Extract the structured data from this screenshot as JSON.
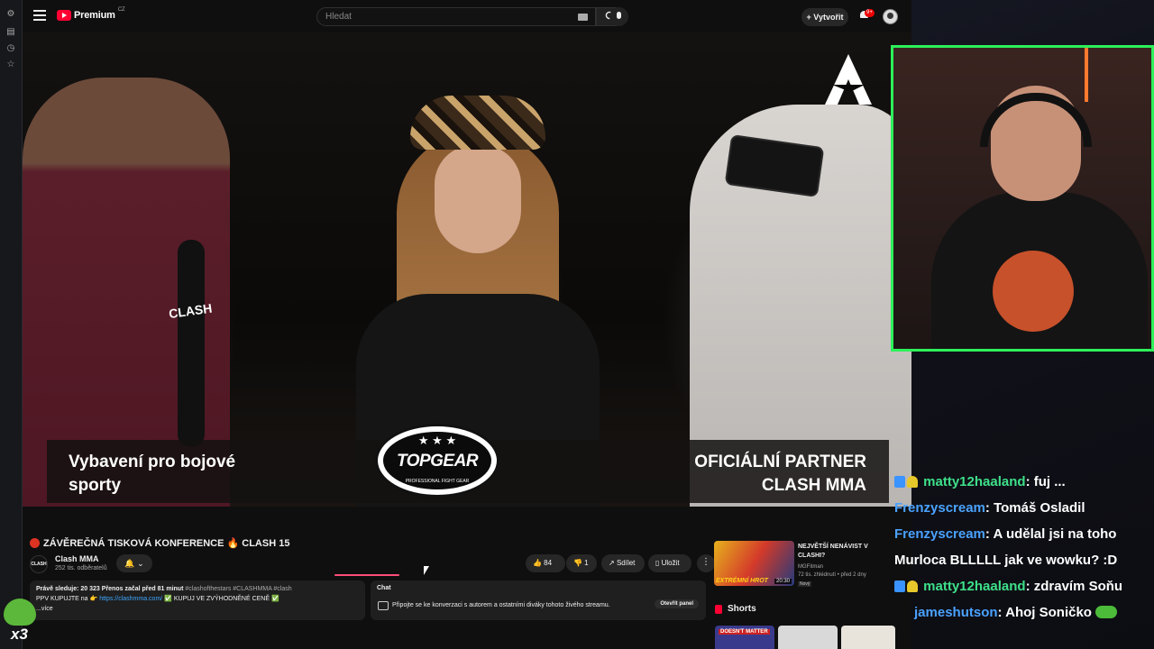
{
  "browser": {
    "rail_icons": [
      "settings-icon",
      "bookmark-icon",
      "history-icon",
      "star-icon"
    ]
  },
  "masthead": {
    "logo_text": "Premium",
    "logo_country": "CZ",
    "search_placeholder": "Hledat",
    "create_label": "+ Vytvořit",
    "notification_count": "9+"
  },
  "video": {
    "mic_label": "CLASH",
    "promo_left": "Vybavení pro bojové sporty",
    "promo_right": "OFICIÁLNÍ PARTNER CLASH MMA",
    "promo_brand": "TOPGEAR",
    "promo_brand_stars": "★ ★ ★",
    "promo_brand_sub": "PROFESSIONAL FIGHT GEAR"
  },
  "info": {
    "title": "ZÁVĚREČNÁ TISKOVÁ KONFERENCE 🔥 CLASH 15",
    "channel_name": "Clash MMA",
    "channel_logo": "CLASH",
    "subscribers": "252 tis. odběratelů",
    "subscribe_label": "🔔 ⌄",
    "likes": "👍 84",
    "dislikes": "👎 1",
    "share_label": "Sdílet",
    "save_label": "Uložit",
    "more_label": "⋮"
  },
  "description": {
    "stats": "Právě sleduje: 20 323  Přenos začal před 81 minut",
    "hashtags": "#clashofthestars #CLASHMMA #clash",
    "line2_prefix": "PPV KUPUJTE na 👉",
    "link": "https://clashmma.com/",
    "line2_suffix": "✅ KUPUJ VE ZVÝHODNĚNÉ CENĚ ✅",
    "more": "...více"
  },
  "chat_panel": {
    "heading": "Chat",
    "message": "Připojte se ke konverzaci s autorem a ostatními diváky tohoto živého streamu.",
    "open_label": "Otevřít panel"
  },
  "recommendation": {
    "title": "NEJVĚTŠÍ NENÁVIST V CLASHI?",
    "thumb_text": "EXTRÉMNÍ HROT",
    "duration": "20:30",
    "channel": "MGFitman",
    "meta": "72 tis. zhlédnutí • před 2 dny",
    "badge": "Nový"
  },
  "shorts": {
    "label": "Shorts",
    "first_thumb_text": "DOESN'T MATTER",
    "thumb_colors": [
      "#3a3a8c",
      "#d9d9d9",
      "#e8e4dc"
    ]
  },
  "stream_chat": [
    {
      "user": "matty12haaland",
      "text": ": fuj ...",
      "color": "#3ee08a",
      "emotes": [
        "box",
        "bell"
      ]
    },
    {
      "user": "Frenzyscream",
      "text": ": Tomáš Osladil",
      "color": "#4aa2ff",
      "emotes": []
    },
    {
      "user": "Frenzyscream",
      "text": ": A udělal jsi na toho",
      "color": "#4aa2ff",
      "emotes": []
    },
    {
      "user": "",
      "text": "Murloca BLLLLL jak ve wowku? :D",
      "color": "#ffffff",
      "emotes": []
    },
    {
      "user": "matty12haaland",
      "text": ": zdravím Soňu",
      "color": "#3ee08a",
      "emotes": [
        "box",
        "bell"
      ]
    },
    {
      "user": "jameshutson",
      "text": ": Ahoj Soničko",
      "color": "#4aa2ff",
      "emotes": [
        "frog"
      ]
    }
  ],
  "overlay": {
    "frog_multiplier": "x3"
  }
}
